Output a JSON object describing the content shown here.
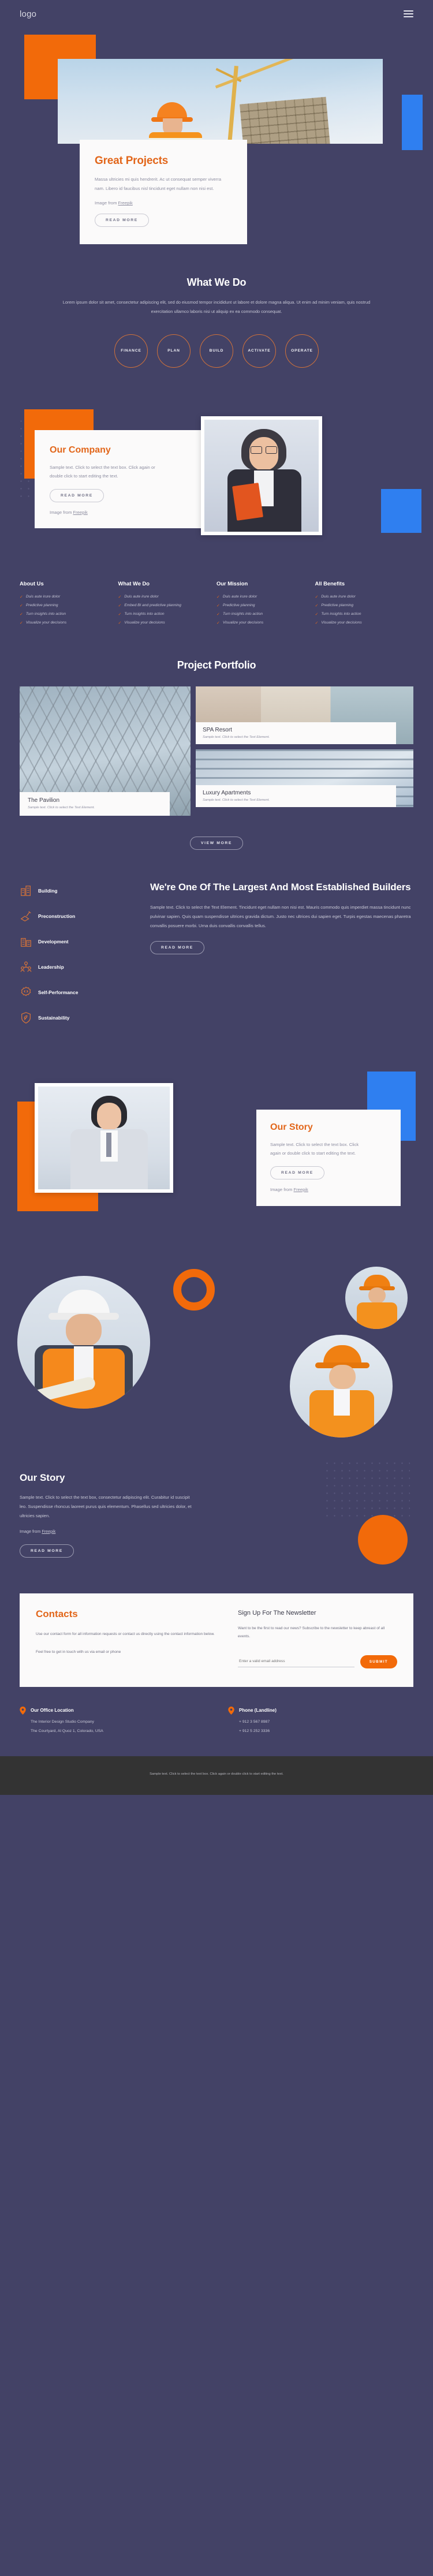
{
  "header": {
    "logo": "logo",
    "menu_icon": "hamburger-menu-icon"
  },
  "hero": {
    "title": "Great Projects",
    "body": "Massa ultricies mi quis hendrerit. Ac ut consequat semper viverra nam. Libero id faucibus nisl tincidunt eget nullam non nisi est.",
    "credit_prefix": "Image from ",
    "credit_link": "Freepik",
    "cta": "READ MORE"
  },
  "what_we_do": {
    "title": "What We Do",
    "subtitle": "Lorem ipsum dolor sit amet, consectetur adipiscing elit, sed do eiusmod tempor incididunt ut labore et dolore magna aliqua. Ut enim ad minim veniam, quis nostrud exercitation ullamco laboris nisi ut aliquip ex ea commodo consequat.",
    "steps": [
      "FINANCE",
      "PLAN",
      "BUILD",
      "ACTIVATE",
      "OPERATE"
    ]
  },
  "company": {
    "title": "Our Company",
    "body": "Sample text. Click to select the text box. Click again or double click to start editing the text.",
    "cta": "READ MORE",
    "credit_prefix": "Image from ",
    "credit_link": "Freepik"
  },
  "link_columns": [
    {
      "title": "About Us",
      "items": [
        "Duis aute irure dolor",
        "Predictive planning",
        "Turn insights into action",
        "Visualize your decisions"
      ]
    },
    {
      "title": "What We Do",
      "items": [
        "Duis aute irure dolor",
        "Embed BI and predictive planning",
        "Turn insights into action",
        "Visualize your decisions"
      ]
    },
    {
      "title": "Our Mission",
      "items": [
        "Duis aute irure dolor",
        "Predictive planning",
        "Turn insights into action",
        "Visualize your decisions"
      ]
    },
    {
      "title": "All Benefits",
      "items": [
        "Duis aute irure dolor",
        "Predictive planning",
        "Turn insights into action",
        "Visualize your decisions"
      ]
    }
  ],
  "portfolio": {
    "title": "Project Portfolio",
    "cards": [
      {
        "name": "The Pavilion",
        "sub": "Sample text. Click to select the Text Element."
      },
      {
        "name": "SPA Resort",
        "sub": "Sample text. Click to select the Text Element."
      },
      {
        "name": "Luxury Apartments",
        "sub": "Sample text. Click to select the Text Element."
      }
    ],
    "cta": "VIEW MORE"
  },
  "builders": {
    "features": [
      {
        "label": "Building",
        "icon": "building-icon"
      },
      {
        "label": "Preconstruction",
        "icon": "trowel-icon"
      },
      {
        "label": "Development",
        "icon": "city-icon"
      },
      {
        "label": "Leadership",
        "icon": "team-icon"
      },
      {
        "label": "Self-Performance",
        "icon": "code-badge-icon"
      },
      {
        "label": "Sustainability",
        "icon": "leaf-shield-icon"
      }
    ],
    "title": "We're One Of The Largest And Most Established Builders",
    "body": "Sample text. Click to select the Text Element. Tincidunt eget nullam non nisi est. Mauris commodo quis imperdiet massa tincidunt nunc pulvinar sapien. Quis quam suspendisse ultrices gravida dictum. Justo nec ultrices dui sapien eget. Turpis egestas maecenas pharetra convallis posuere morbi. Urna duis convallis convallis tellus.",
    "cta": "READ MORE"
  },
  "story_photo": {
    "title": "Our Story",
    "body": "Sample text. Click to select the text box. Click again or double click to start editing the text.",
    "cta": "READ MORE",
    "credit_prefix": "Image from ",
    "credit_link": "Freepik"
  },
  "story_text": {
    "title": "Our Story",
    "body": "Sample text. Click to select the text box, consectetur adipiscing elit. Curabitur id suscipit leo. Suspendisse rhoncus laoreet purus quis elementum. Phasellus sed ultricies dolor, et ultricies sapien.",
    "credit_prefix": "Image from ",
    "credit_link": "Freepik",
    "cta": "READ MORE"
  },
  "contacts": {
    "title": "Contacts",
    "body": "Use our contact form for all information requests or contact us directly using the contact information below.",
    "body2": "Feel free to get in touch with us via email or phone",
    "newsletter_title": "Sign Up For The Newsletter",
    "newsletter_body": "Want to be the first to read our news? Subscribe to the newsletter to keep abreast of all events.",
    "email_placeholder": "Enter a valid email address",
    "email_value": "",
    "submit": "SUBMIT"
  },
  "address": {
    "office_title": "Our Office Location",
    "office_line1": "The Interior Design Studio Company",
    "office_line2": "The Courtyard, Al Quoz 1, Colorado,  USA",
    "phone_title": "Phone (Landline)",
    "phone_line1": "+ 912 3 567 8987",
    "phone_line2": "+ 912 5 252 3336"
  },
  "bottom": {
    "text": "Sample text. Click to select the text box. Click again or double click to start editing the text."
  },
  "colors": {
    "background": "#434266",
    "accent_orange": "#f26a0a",
    "accent_blue": "#2f7ff0",
    "card_white": "#fbfafa",
    "bottom_bar": "#333333"
  }
}
